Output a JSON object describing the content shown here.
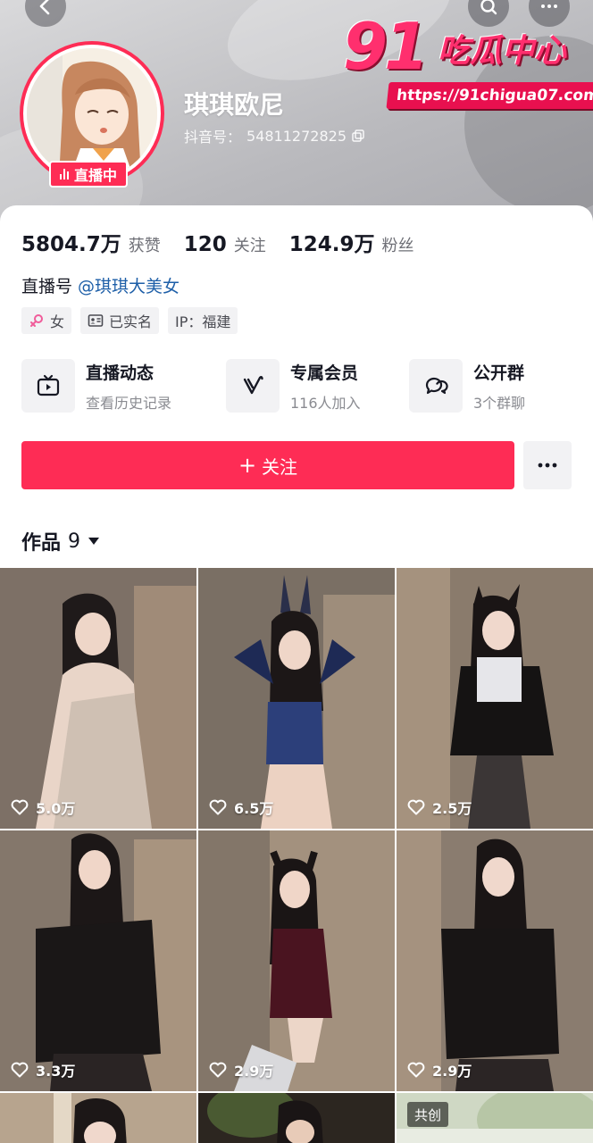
{
  "header": {
    "nickname": "琪琪欧尼",
    "account_label": "抖音号：",
    "account_id": "54811272825",
    "live_badge": "直播中",
    "icons": [
      "chevron-left-icon",
      "search-icon",
      "more-horizontal-icon",
      "copy-icon"
    ]
  },
  "watermark": {
    "big": "91",
    "text": "吃瓜中心",
    "url": "https://91chigua07.com"
  },
  "stats": [
    {
      "value": "5804.7万",
      "label": "获赞"
    },
    {
      "value": "120",
      "label": "关注"
    },
    {
      "value": "124.9万",
      "label": "粉丝"
    }
  ],
  "live_id": {
    "label": "直播号",
    "handle": "@琪琪大美女"
  },
  "tags": [
    {
      "icon": "female-icon",
      "text": "女"
    },
    {
      "icon": "id-card-icon",
      "text": "已实名"
    },
    {
      "icon": "",
      "text": "IP：福建"
    }
  ],
  "features": [
    {
      "icon": "tv-icon",
      "title": "直播动态",
      "subtitle": "查看历史记录"
    },
    {
      "icon": "vip-v-icon",
      "title": "专属会员",
      "subtitle": "116人加入"
    },
    {
      "icon": "chat-group-icon",
      "title": "公开群",
      "subtitle": "3个群聊"
    }
  ],
  "actions": {
    "follow_label": "关注",
    "follow_plus": "+"
  },
  "works_tab": {
    "label": "作品",
    "count": "9"
  },
  "videos": [
    {
      "likes": "5.0万"
    },
    {
      "likes": "6.5万"
    },
    {
      "likes": "2.5万"
    },
    {
      "likes": "3.3万"
    },
    {
      "likes": "2.9万"
    },
    {
      "likes": "2.9万"
    },
    {
      "likes": ""
    },
    {
      "likes": ""
    },
    {
      "likes": "",
      "badge": "共创"
    }
  ],
  "colors": {
    "accent": "#fe2c55",
    "link": "#1e5fa8",
    "text_primary": "#161823",
    "text_secondary": "#8a8b91",
    "chip_bg": "#f2f2f4"
  }
}
